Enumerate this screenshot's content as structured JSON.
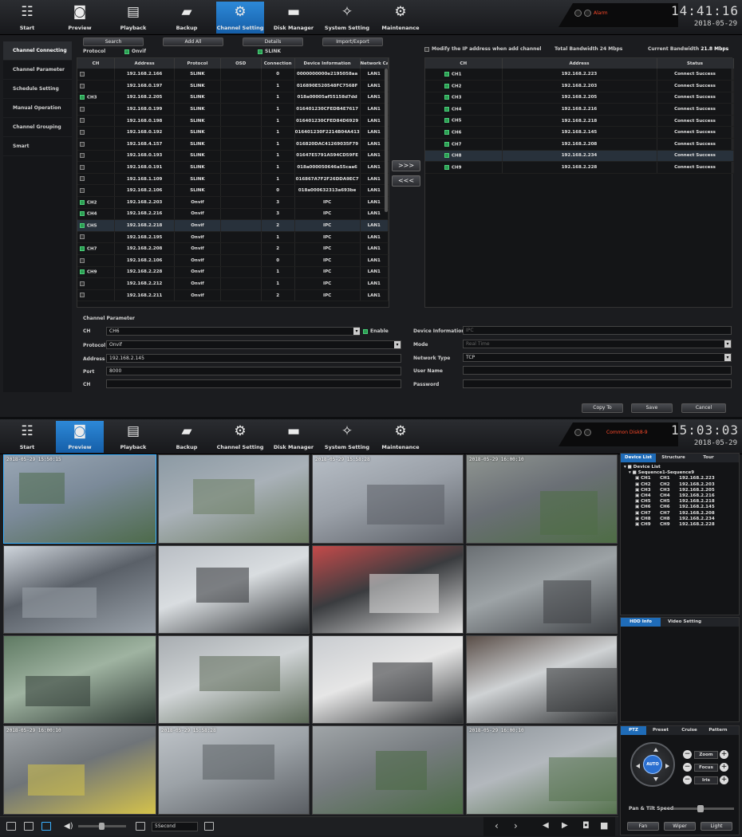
{
  "colors": {
    "accent": "#1f6cb8",
    "alarm": "#ff4a2a",
    "checked": "#2c9d52"
  },
  "nav": [
    {
      "label": "Start",
      "icon": "grid-icon"
    },
    {
      "label": "Preview",
      "icon": "camera-icon"
    },
    {
      "label": "Playback",
      "icon": "film-icon"
    },
    {
      "label": "Backup",
      "icon": "folder-icon"
    },
    {
      "label": "Channel Setting",
      "icon": "channel-icon"
    },
    {
      "label": "Disk Manager",
      "icon": "disk-icon"
    },
    {
      "label": "System Setting",
      "icon": "system-icon"
    },
    {
      "label": "Maintenance",
      "icon": "gear-icon"
    }
  ],
  "top": {
    "status": "Alarm",
    "time": "14:41:16",
    "date": "2018-05-29",
    "sidebar": [
      "Channel Connecting",
      "Channel Parameter",
      "Schedule Setting",
      "Manual Operation",
      "Channel Grouping",
      "Smart"
    ],
    "toolbar": {
      "search": "Search",
      "add_all": "Add All",
      "details": "Details",
      "import_export": "Import/Export"
    },
    "filter": {
      "protocol_label": "Protocol",
      "onvif": "Onvif",
      "slink": "SLINK"
    },
    "left_table": {
      "headers": [
        "CH",
        "Address",
        "Protocol",
        "OSD",
        "Connection",
        "Device Information",
        "Network Card"
      ],
      "rows": [
        [
          "",
          "192.168.2.166",
          "SLINK",
          "",
          "0",
          "0000000000e2195058aa",
          "LAN1"
        ],
        [
          "",
          "192.168.0.197",
          "SLINK",
          "",
          "1",
          "016890E520548FC7568F",
          "LAN1"
        ],
        [
          "CH3",
          "192.168.2.205",
          "SLINK",
          "",
          "1",
          "018a00005af55158d7dd",
          "LAN1"
        ],
        [
          "",
          "192.168.0.199",
          "SLINK",
          "",
          "1",
          "016401230CFEDB4E7617",
          "LAN1"
        ],
        [
          "",
          "192.168.0.198",
          "SLINK",
          "",
          "1",
          "016401230CFED84D6929",
          "LAN1"
        ],
        [
          "",
          "192.168.0.192",
          "SLINK",
          "",
          "1",
          "016401230F2214B04A413",
          "LAN1"
        ],
        [
          "",
          "192.168.4.157",
          "SLINK",
          "",
          "1",
          "016820DAC41269035F79",
          "LAN1"
        ],
        [
          "",
          "192.168.0.193",
          "SLINK",
          "",
          "1",
          "01647E5791A594CD59FE",
          "LAN1"
        ],
        [
          "",
          "192.168.0.191",
          "SLINK",
          "",
          "1",
          "018a000050646a55caa6",
          "LAN1"
        ],
        [
          "",
          "192.168.1.109",
          "SLINK",
          "",
          "1",
          "016867A7F2F26DDA9EC7",
          "LAN1"
        ],
        [
          "",
          "192.168.2.106",
          "SLINK",
          "",
          "0",
          "018a000632313a693be",
          "LAN1"
        ],
        [
          "CH2",
          "192.168.2.203",
          "Onvif",
          "",
          "3",
          "IPC",
          "LAN1"
        ],
        [
          "CH4",
          "192.168.2.216",
          "Onvif",
          "",
          "3",
          "IPC",
          "LAN1"
        ],
        [
          "CH5",
          "192.168.2.218",
          "Onvif",
          "",
          "2",
          "IPC",
          "LAN1"
        ],
        [
          "",
          "192.168.2.195",
          "Onvif",
          "",
          "1",
          "IPC",
          "LAN1"
        ],
        [
          "CH7",
          "192.168.2.208",
          "Onvif",
          "",
          "2",
          "IPC",
          "LAN1"
        ],
        [
          "",
          "192.168.2.106",
          "Onvif",
          "",
          "0",
          "IPC",
          "LAN1"
        ],
        [
          "CH9",
          "192.168.2.228",
          "Onvif",
          "",
          "1",
          "IPC",
          "LAN1"
        ],
        [
          "",
          "192.168.2.212",
          "Onvif",
          "",
          "1",
          "IPC",
          "LAN1"
        ],
        [
          "",
          "192.168.2.211",
          "Onvif",
          "",
          "2",
          "IPC",
          "LAN1"
        ]
      ]
    },
    "modify_label": "Modify the IP address when add channel",
    "bandwidth": {
      "total": "Total Bandwidth 24 Mbps",
      "current_label": "Current Bandwidth",
      "current_value": "21.8 Mbps"
    },
    "right_table": {
      "headers": [
        "CH",
        "Address",
        "Status"
      ],
      "rows": [
        [
          "CH1",
          "192.168.2.223",
          "Connect Success"
        ],
        [
          "CH2",
          "192.168.2.203",
          "Connect Success"
        ],
        [
          "CH3",
          "192.168.2.205",
          "Connect Success"
        ],
        [
          "CH4",
          "192.168.2.216",
          "Connect Success"
        ],
        [
          "CH5",
          "192.168.2.218",
          "Connect Success"
        ],
        [
          "CH6",
          "192.168.2.145",
          "Connect Success"
        ],
        [
          "CH7",
          "192.168.2.208",
          "Connect Success"
        ],
        [
          "CH8",
          "192.168.2.234",
          "Connect Success"
        ],
        [
          "CH9",
          "192.168.2.228",
          "Connect Success"
        ]
      ]
    },
    "add_arrow": ">>>",
    "remove_arrow": "<<<",
    "param": {
      "title": "Channel Parameter",
      "ch_label": "CH",
      "ch_value": "CH6",
      "enable": "Enable",
      "protocol_label": "Protocol",
      "protocol_value": "Onvif",
      "address_label": "Address",
      "address_value": "192.168.2.145",
      "port_label": "Port",
      "port_value": "8000",
      "ch2_label": "CH",
      "devinfo_label": "Device Information",
      "devinfo_value": "IPC",
      "mode_label": "Mode",
      "mode_value": "Real Time",
      "nettype_label": "Network Type",
      "nettype_value": "TCP",
      "user_label": "User Name",
      "password_label": "Password"
    },
    "buttons": {
      "copy": "Copy To",
      "save": "Save",
      "cancel": "Cancel"
    }
  },
  "bottom": {
    "status": "Common Disk8-9",
    "time": "15:03:03",
    "date": "2018-05-29",
    "cams": [
      {
        "ts": "2018-05-29 15:50:15"
      },
      {
        "ts": ""
      },
      {
        "ts": "2018-05-29 15:58:28"
      },
      {
        "ts": "2018-05-29 16:00:10"
      },
      {
        "ts": ""
      },
      {
        "ts": ""
      },
      {
        "ts": ""
      },
      {
        "ts": ""
      },
      {
        "ts": ""
      },
      {
        "ts": ""
      },
      {
        "ts": ""
      },
      {
        "ts": ""
      },
      {
        "ts": "2018-05-29 16:00:10"
      },
      {
        "ts": "2018-05-29 15:58:28"
      },
      {
        "ts": ""
      },
      {
        "ts": "2018-05-29 16:00:10"
      }
    ],
    "tabs1": [
      "Device List",
      "Structure",
      "Tour"
    ],
    "tree_root": "Device List",
    "tree_seq": "Sequence1-Sequence9",
    "devices": [
      [
        "CH1",
        "CH1",
        "192.168.2.223"
      ],
      [
        "CH2",
        "CH2",
        "192.168.2.203"
      ],
      [
        "CH3",
        "CH3",
        "192.168.2.205"
      ],
      [
        "CH4",
        "CH4",
        "192.168.2.216"
      ],
      [
        "CH5",
        "CH5",
        "192.168.2.218"
      ],
      [
        "CH6",
        "CH6",
        "192.168.2.145"
      ],
      [
        "CH7",
        "CH7",
        "192.168.2.208"
      ],
      [
        "CH8",
        "CH8",
        "192.168.2.234"
      ],
      [
        "CH9",
        "CH9",
        "192.168.2.228"
      ]
    ],
    "tabs2": [
      "HDD Info",
      "Video Setting"
    ],
    "tabs3": [
      "PTZ",
      "Preset",
      "Cruise",
      "Pattern"
    ],
    "ptz": {
      "auto": "AUTO",
      "zoom": "Zoom",
      "focus": "Focus",
      "iris": "Iris",
      "speed": "Pan & Tilt Speed",
      "fan": "Fan",
      "wiper": "Wiper",
      "light": "Light"
    },
    "interval": "5Second"
  }
}
